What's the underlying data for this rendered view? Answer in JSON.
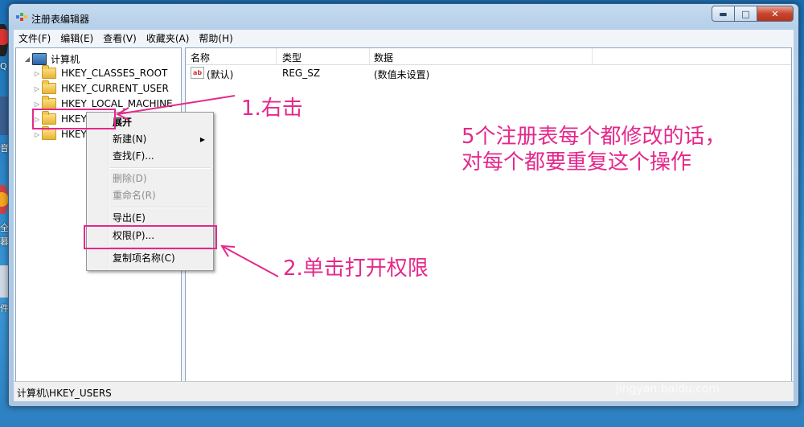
{
  "desktop": {
    "labels": [
      "Q",
      "音",
      "全",
      "暮",
      "件"
    ]
  },
  "window": {
    "title": "注册表编辑器",
    "buttons": {
      "minimize": "▬",
      "maximize": "□",
      "close": "✕"
    }
  },
  "menu": [
    "文件(F)",
    "编辑(E)",
    "查看(V)",
    "收藏夹(A)",
    "帮助(H)"
  ],
  "tree": {
    "root": "计算机",
    "items": [
      "HKEY_CLASSES_ROOT",
      "HKEY_CURRENT_USER",
      "HKEY_LOCAL_MACHINE",
      "HKEY",
      "HKEY"
    ]
  },
  "list": {
    "columns": [
      "名称",
      "类型",
      "数据"
    ],
    "rows": [
      {
        "name": "(默认)",
        "type": "REG_SZ",
        "data": "(数值未设置)"
      }
    ]
  },
  "context_menu": {
    "items": [
      "展开",
      "新建(N)",
      "查找(F)...",
      "删除(D)",
      "重命名(R)",
      "导出(E)",
      "权限(P)...",
      "复制项名称(C)"
    ]
  },
  "status": "计算机\\HKEY_USERS",
  "annotations": {
    "step1": "1.右击",
    "step2": "2.单击打开权限",
    "note": "5个注册表每个都修改的话，对每个都要重复这个操作"
  },
  "watermark": {
    "main": "Baidu经验",
    "sub": "jingyan.baidu.com"
  },
  "colors": {
    "annotation": "#e5288c",
    "desktop": "#2c86c9"
  }
}
